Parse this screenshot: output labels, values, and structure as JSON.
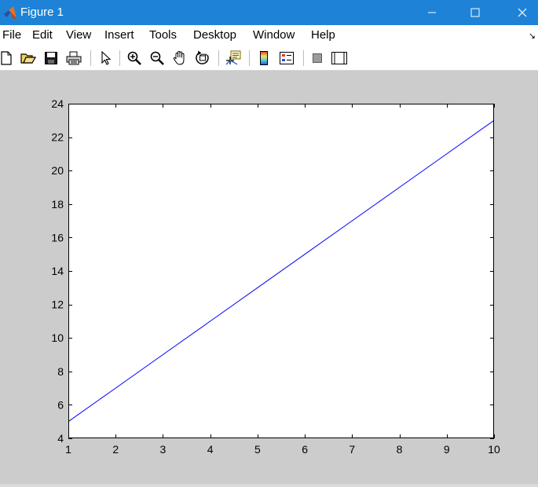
{
  "window": {
    "title": "Figure 1",
    "minimize_glyph": "minimize-icon",
    "maximize_glyph": "maximize-icon",
    "close_glyph": "close-icon"
  },
  "menu": {
    "items": [
      "File",
      "Edit",
      "View",
      "Insert",
      "Tools",
      "Desktop",
      "Window",
      "Help"
    ]
  },
  "toolbar": {
    "buttons": [
      "new-figure-icon",
      "open-file-icon",
      "save-icon",
      "print-icon",
      "edit-plot-arrow-icon",
      "zoom-in-icon",
      "zoom-out-icon",
      "pan-hand-icon",
      "rotate-3d-icon",
      "data-cursor-icon",
      "insert-colorbar-icon",
      "insert-legend-icon",
      "hide-plot-tools-icon",
      "show-plot-tools-icon"
    ]
  },
  "colors": {
    "line": "#0000ff",
    "titlebar": "#1e83d6",
    "figure_background": "#cccccc",
    "axes_background": "#ffffff"
  },
  "chart_data": {
    "type": "line",
    "x": [
      1,
      2,
      3,
      4,
      5,
      6,
      7,
      8,
      9,
      10
    ],
    "series": [
      {
        "values": [
          5,
          7,
          9,
          11,
          13,
          15,
          17,
          19,
          21,
          23
        ]
      }
    ],
    "xlim": [
      1,
      10
    ],
    "ylim": [
      4,
      24
    ],
    "xticks": [
      1,
      2,
      3,
      4,
      5,
      6,
      7,
      8,
      9,
      10
    ],
    "yticks": [
      4,
      6,
      8,
      10,
      12,
      14,
      16,
      18,
      20,
      22,
      24
    ],
    "grid": false,
    "title": "",
    "xlabel": "",
    "ylabel": ""
  }
}
